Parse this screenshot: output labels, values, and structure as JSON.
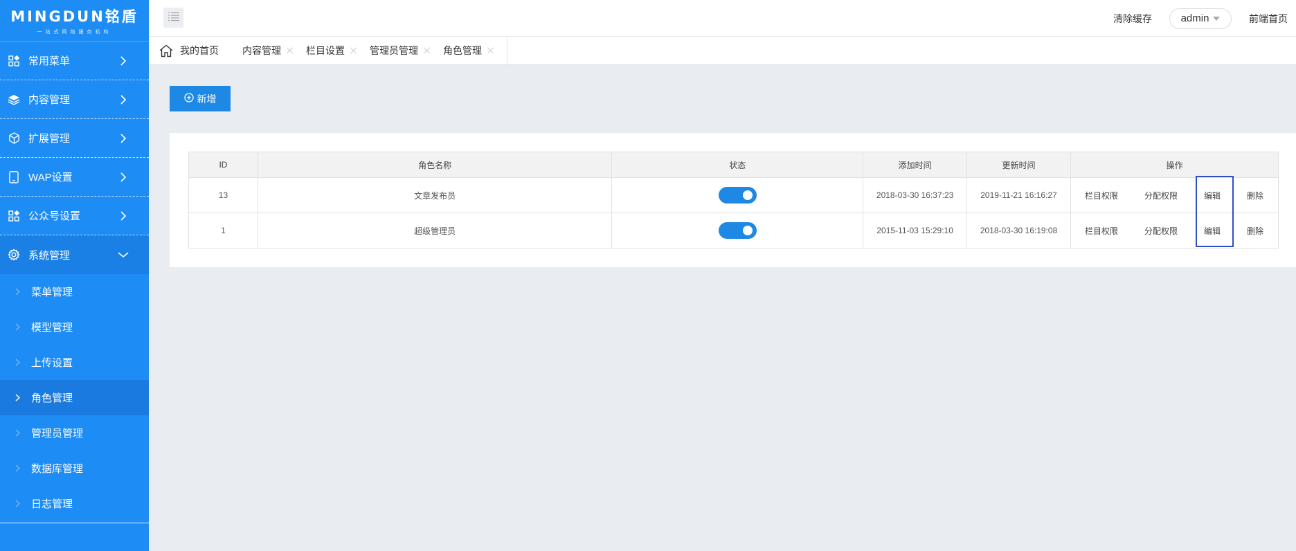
{
  "logo": {
    "main": "MINGDUN铭盾",
    "sub": "一站式网络服务机构"
  },
  "sidebar": {
    "menus": [
      {
        "label": "常用菜单",
        "icon": "grid-apps-icon"
      },
      {
        "label": "内容管理",
        "icon": "layers-icon"
      },
      {
        "label": "扩展管理",
        "icon": "cube-icon"
      },
      {
        "label": "WAP设置",
        "icon": "tablet-icon"
      },
      {
        "label": "公众号设置",
        "icon": "grid-apps-icon"
      },
      {
        "label": "系统管理",
        "icon": "gear-icon"
      }
    ],
    "subitems": [
      {
        "label": "菜单管理"
      },
      {
        "label": "模型管理"
      },
      {
        "label": "上传设置"
      },
      {
        "label": "角色管理"
      },
      {
        "label": "管理员管理"
      },
      {
        "label": "数据库管理"
      },
      {
        "label": "日志管理"
      }
    ]
  },
  "header": {
    "clear_cache": "清除缓存",
    "user": "admin",
    "frontend": "前端首页"
  },
  "tabs": [
    {
      "label": "我的首页"
    },
    {
      "label": "内容管理"
    },
    {
      "label": "栏目设置"
    },
    {
      "label": "管理员管理"
    },
    {
      "label": "角色管理"
    }
  ],
  "toolbar": {
    "add_label": "新增"
  },
  "table": {
    "headers": [
      "ID",
      "角色名称",
      "状态",
      "添加时间",
      "更新时间",
      "操作"
    ],
    "rows": [
      {
        "id": "13",
        "name": "文章发布员",
        "enabled": true,
        "created": "2018-03-30 16:37:23",
        "updated": "2019-11-21 16:16:27",
        "ops": [
          "栏目权限",
          "分配权限",
          "编辑",
          "删除"
        ]
      },
      {
        "id": "1",
        "name": "超级管理员",
        "enabled": true,
        "created": "2015-11-03 15:29:10",
        "updated": "2018-03-30 16:19:08",
        "ops": [
          "栏目权限",
          "分配权限",
          "编辑",
          "删除"
        ]
      }
    ]
  },
  "colors": {
    "sidebar": "#1e8cf5",
    "accent": "#1e88e5",
    "highlight": "#2e4fc4"
  }
}
